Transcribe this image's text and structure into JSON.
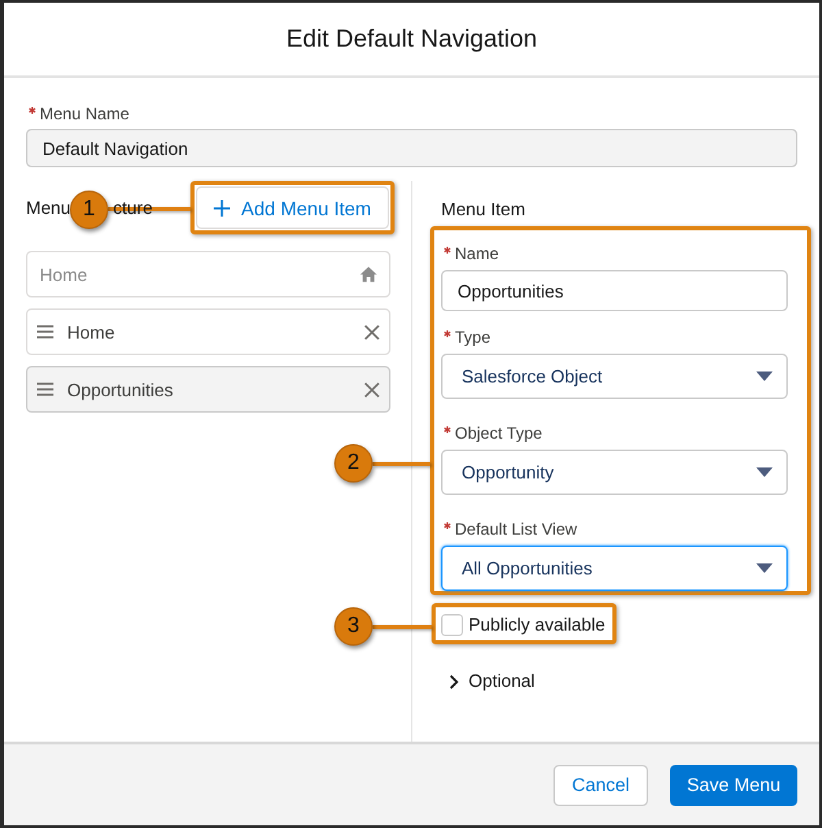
{
  "modal": {
    "title": "Edit Default Navigation"
  },
  "menu_name": {
    "label": "Menu Name",
    "required": true,
    "value": "Default Navigation",
    "disabled": true
  },
  "menu_structure": {
    "label_parts": [
      "Menu",
      "cture"
    ],
    "add_button": {
      "label": "Add Menu Item"
    },
    "items": [
      {
        "kind": "fixed",
        "label": "Home",
        "selected": false
      },
      {
        "kind": "item",
        "label": "Home",
        "selected": false
      },
      {
        "kind": "item",
        "label": "Opportunities",
        "selected": true
      }
    ]
  },
  "menu_item": {
    "title": "Menu Item",
    "fields": [
      {
        "kind": "text",
        "label": "Name",
        "required": true,
        "value": "Opportunities",
        "focused": false
      },
      {
        "kind": "select",
        "label": "Type",
        "required": true,
        "value": "Salesforce Object",
        "focused": false
      },
      {
        "kind": "select",
        "label": "Object Type",
        "required": true,
        "value": "Opportunity",
        "focused": false
      },
      {
        "kind": "select",
        "label": "Default List View",
        "required": true,
        "value": "All Opportunities",
        "focused": true
      }
    ],
    "publicly_available": {
      "label": "Publicly available",
      "checked": false
    },
    "optional": {
      "label": "Optional",
      "expanded": false
    }
  },
  "callouts": [
    {
      "number": "1"
    },
    {
      "number": "2"
    },
    {
      "number": "3"
    }
  ],
  "footer": {
    "buttons": [
      {
        "kind": "neutral",
        "label": "Cancel"
      },
      {
        "kind": "brand",
        "label": "Save Menu"
      }
    ]
  }
}
